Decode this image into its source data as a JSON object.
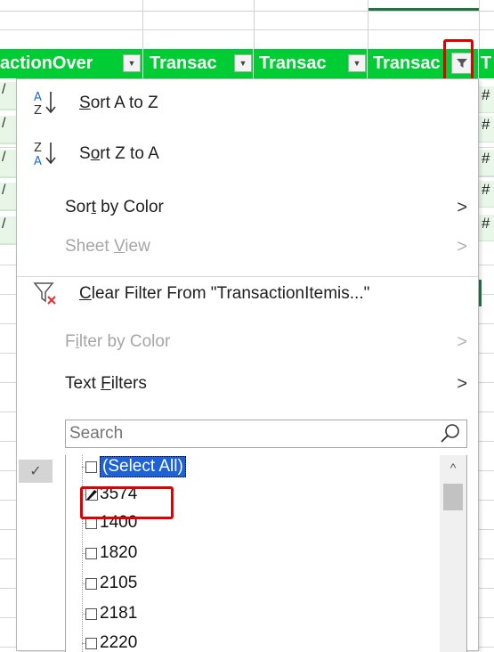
{
  "header": {
    "cells": [
      "actionOver",
      "Transac",
      "Transac",
      "Transac",
      "T"
    ]
  },
  "sheet": {
    "right_values": [
      "#",
      "#",
      "#",
      "#",
      "#"
    ],
    "left_values": [
      "/",
      "/",
      "/",
      "/",
      "/"
    ]
  },
  "menu": {
    "sort_az": {
      "pre": "",
      "u": "S",
      "post": "ort A to Z"
    },
    "sort_za": {
      "pre": "S",
      "u": "o",
      "post": "rt Z to A"
    },
    "sort_color": {
      "pre": "Sor",
      "u": "t",
      "post": " by Color"
    },
    "sheet_view": {
      "pre": "Sheet ",
      "u": "V",
      "post": "iew"
    },
    "clear_filter": {
      "pre": "",
      "u": "C",
      "post": "lear Filter From \"TransactionItemis...\""
    },
    "filter_color": {
      "pre": "F",
      "u": "i",
      "post": "lter by Color"
    },
    "text_filters": {
      "pre": "Text ",
      "u": "F",
      "post": "ilters"
    },
    "arrow": ">"
  },
  "search": {
    "placeholder": "Search"
  },
  "list": {
    "select_all": "(Select All)",
    "items": [
      "3574",
      "1400",
      "1820",
      "2105",
      "2181",
      "2220"
    ]
  },
  "colors": {
    "header_green": "#00cc33",
    "highlight_red": "#e00000",
    "selection_blue": "#1d63d6"
  }
}
